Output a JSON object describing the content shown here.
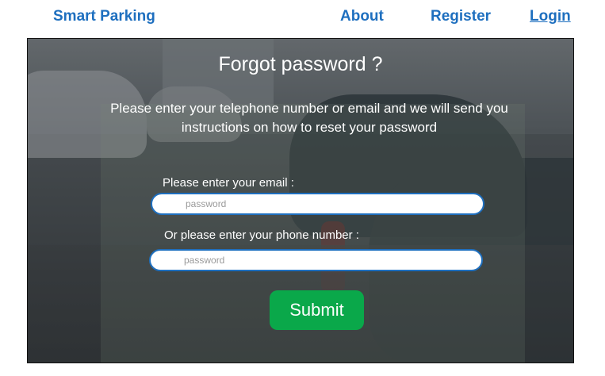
{
  "nav": {
    "brand": "Smart Parking",
    "about": "About",
    "register": "Register",
    "login": "Login"
  },
  "hero": {
    "title": "Forgot password ?",
    "description": "Please enter your telephone number or email and we will send you instructions on how to reset your password",
    "email_label": "Please enter your email :",
    "email_placeholder": "password",
    "phone_label": "Or please enter your phone number :",
    "phone_placeholder": "password",
    "submit_label": "Submit"
  },
  "colors": {
    "nav_link": "#1e6fbf",
    "submit": "#0aa84a"
  }
}
